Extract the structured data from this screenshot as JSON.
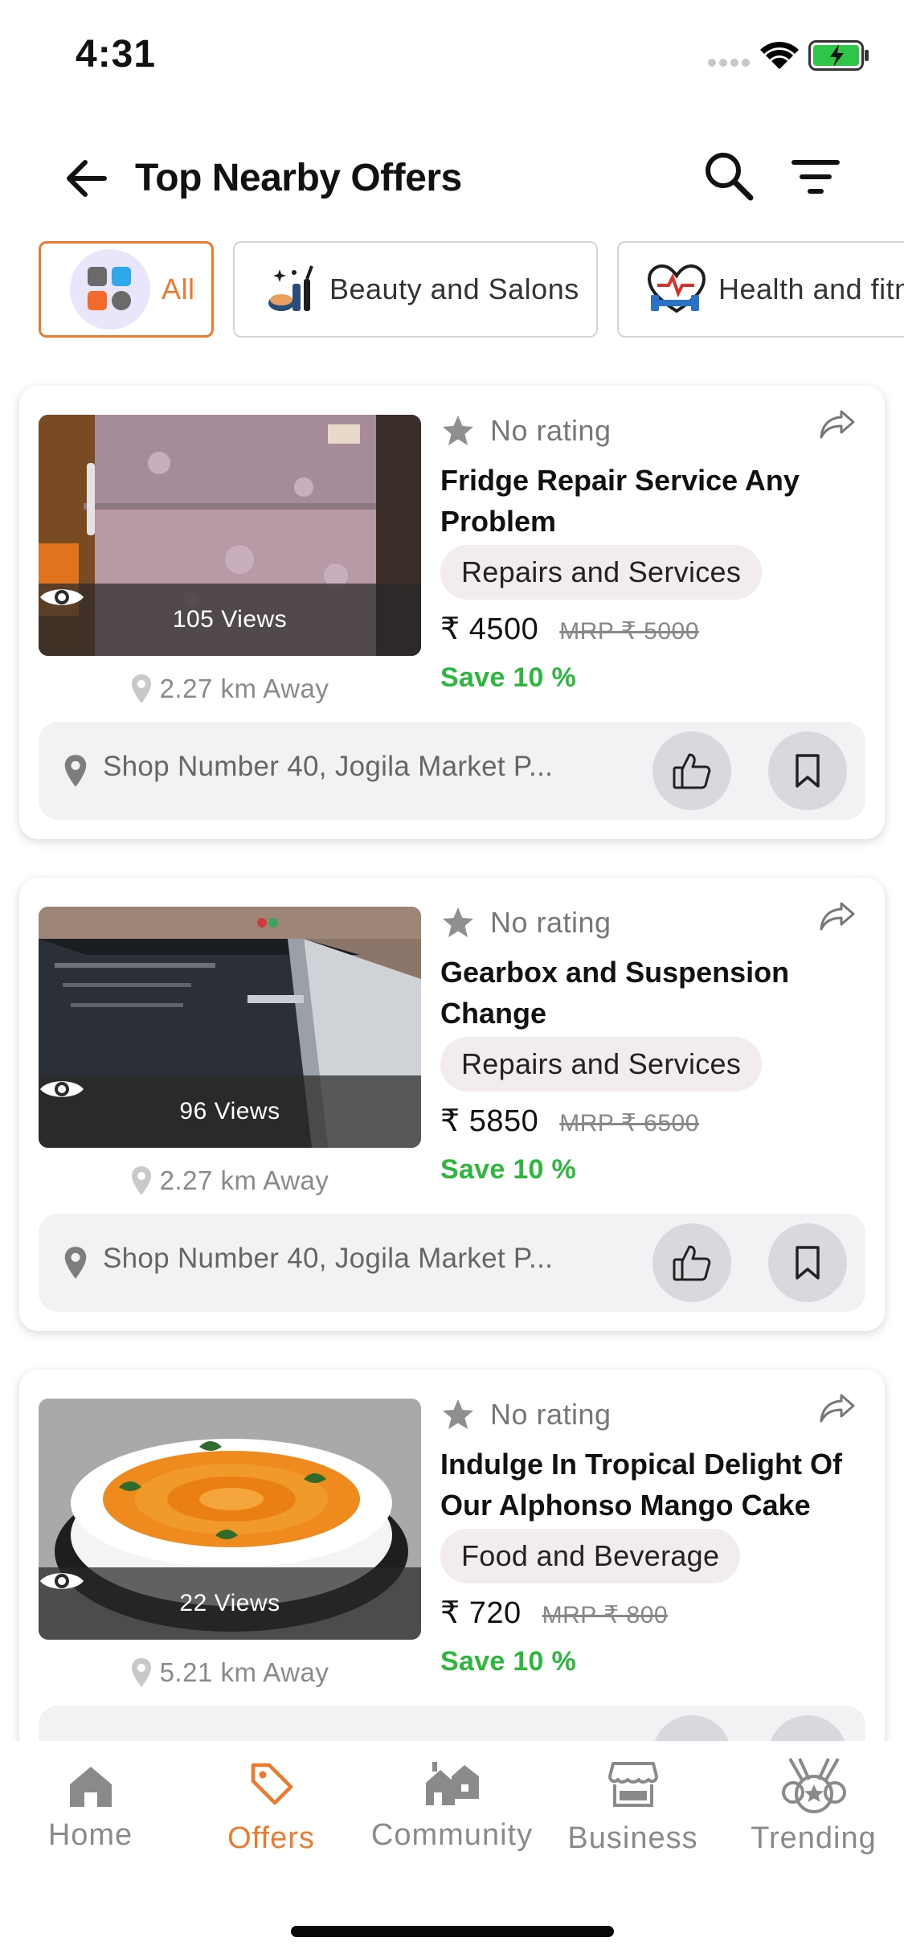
{
  "status_bar": {
    "time": "4:31"
  },
  "header": {
    "title": "Top Nearby Offers"
  },
  "categories": [
    {
      "label": "All",
      "active": true
    },
    {
      "label": "Beauty and Salons",
      "active": false
    },
    {
      "label": "Health and fitness",
      "active": false
    }
  ],
  "offers": [
    {
      "rating": "No rating",
      "title": "Fridge Repair Service Any Problem",
      "category": "Repairs and Services",
      "price": "₹ 4500",
      "mrp": "MRP ₹ 5000",
      "save": "Save 10 %",
      "views": "105 Views",
      "distance": "2.27 km Away",
      "address": "Shop Number 40, Jogila Market P..."
    },
    {
      "rating": "No rating",
      "title": "Gearbox and Suspension Change",
      "category": "Repairs and Services",
      "price": "₹ 5850",
      "mrp": "MRP ₹ 6500",
      "save": "Save 10 %",
      "views": "96 Views",
      "distance": "2.27 km Away",
      "address": "Shop Number 40, Jogila Market P..."
    },
    {
      "rating": "No rating",
      "title": "Indulge In Tropical Delight Of Our Alphonso Mango Cake Fill...",
      "category": "Food and Beverage",
      "price": "₹ 720",
      "mrp": "MRP ₹ 800",
      "save": "Save 10 %",
      "views": "22 Views",
      "distance": "5.21 km Away",
      "address": ""
    }
  ],
  "bottom_nav": [
    {
      "label": "Home",
      "icon": "home-icon",
      "active": false
    },
    {
      "label": "Offers",
      "icon": "tag-icon",
      "active": true
    },
    {
      "label": "Community",
      "icon": "community-icon",
      "active": false
    },
    {
      "label": "Business",
      "icon": "store-icon",
      "active": false
    },
    {
      "label": "Trending",
      "icon": "medal-icon",
      "active": false
    }
  ],
  "colors": {
    "accent": "#ee7a2e",
    "save_green": "#2db83d",
    "badge_bg": "#f2ecec"
  }
}
